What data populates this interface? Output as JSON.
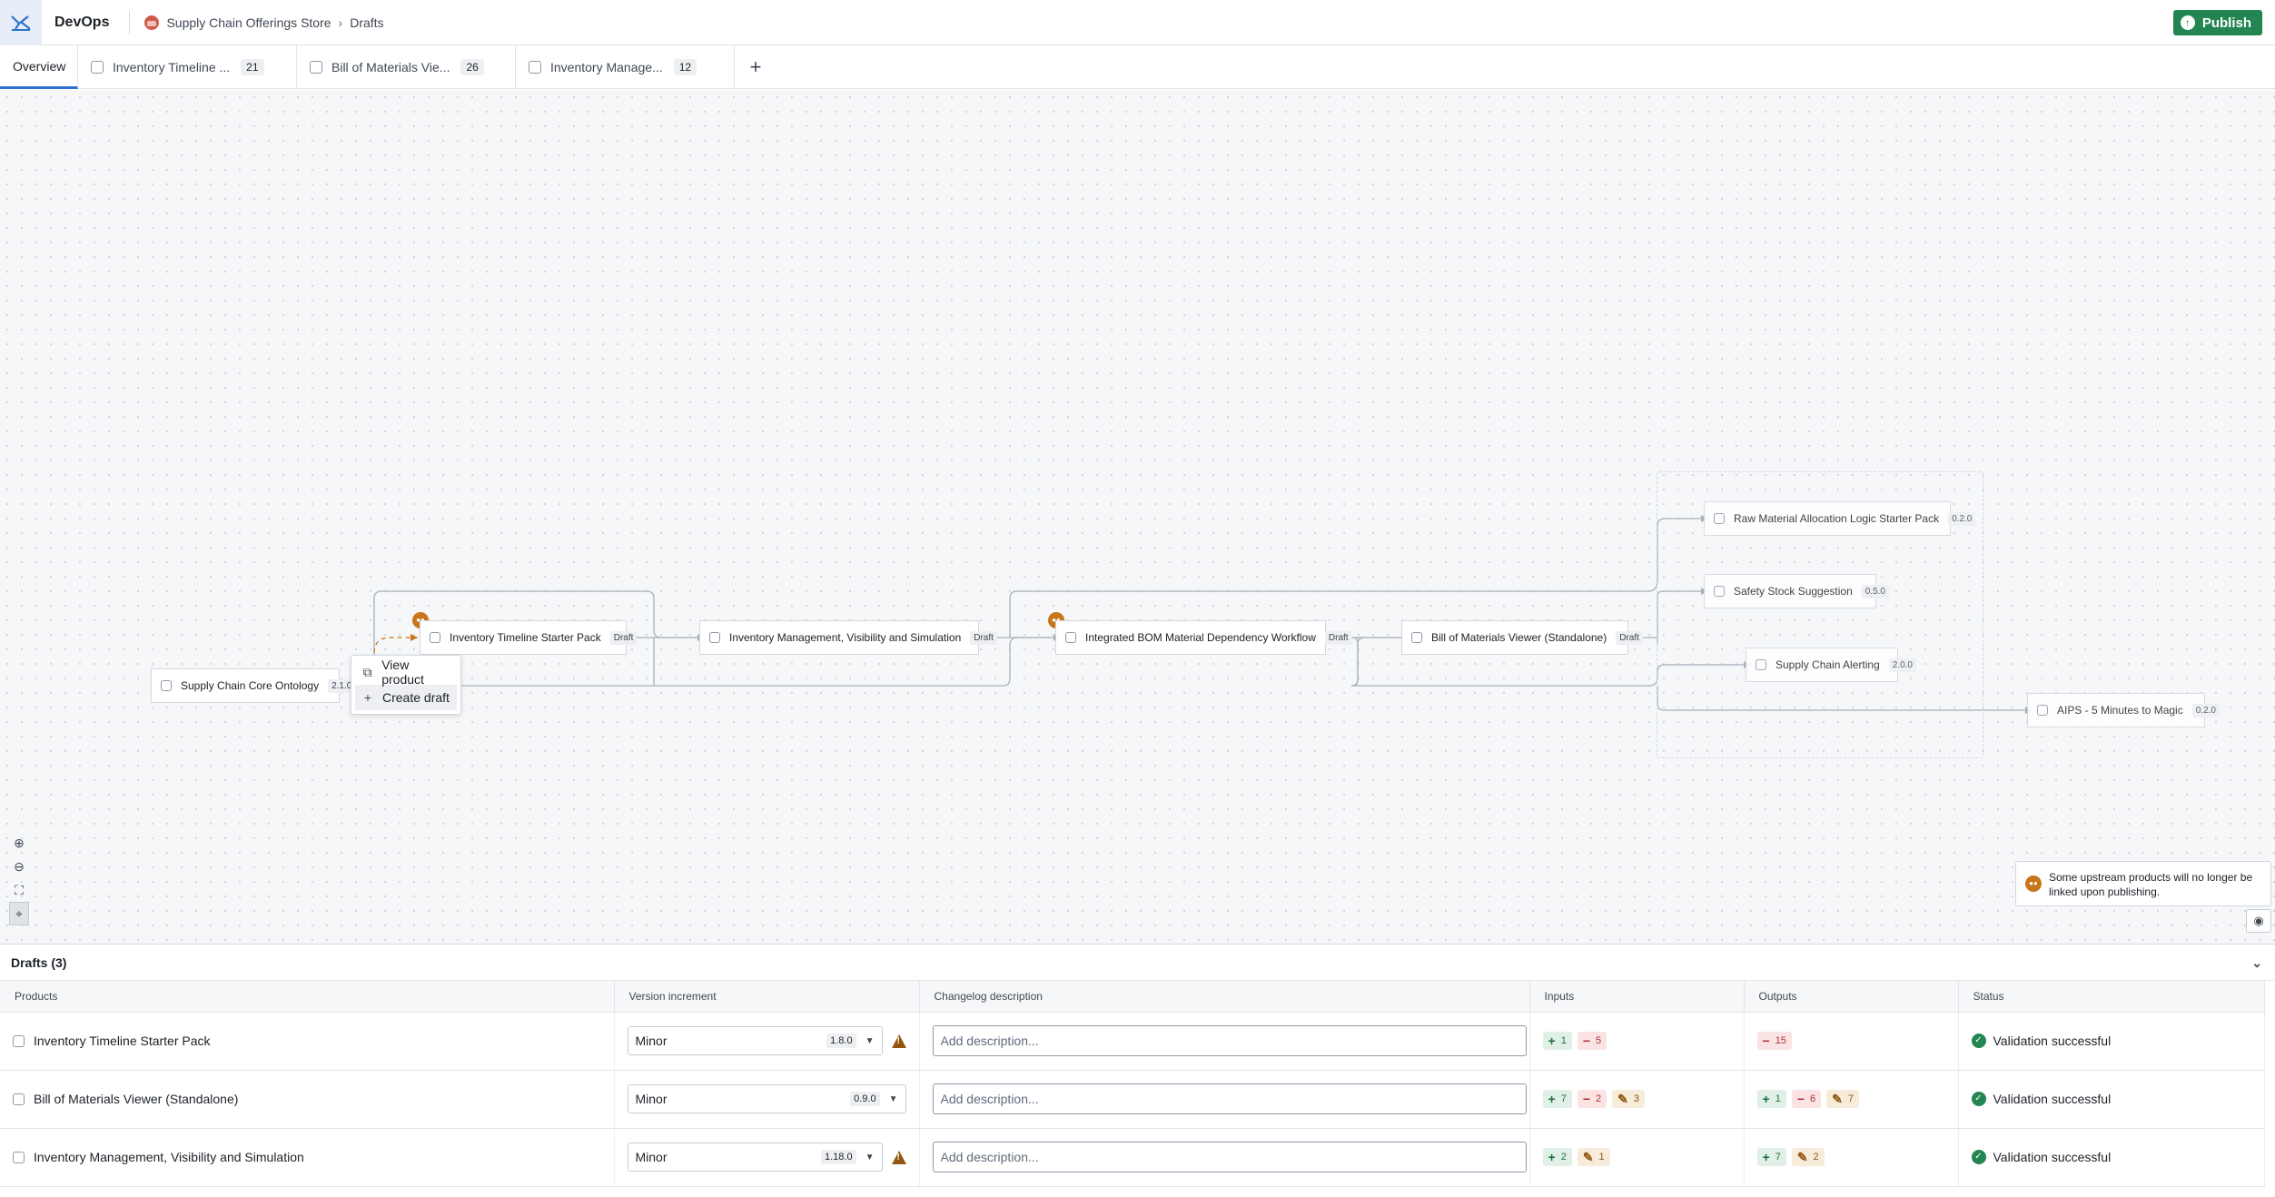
{
  "header": {
    "app_name": "DevOps",
    "breadcrumb": [
      "Supply Chain Offerings Store",
      "Drafts"
    ],
    "publish_label": "Publish"
  },
  "tabs": [
    {
      "label": "Overview",
      "count": "",
      "active": true
    },
    {
      "label": "Inventory Timeline ...",
      "count": "21"
    },
    {
      "label": "Bill of Materials Vie...",
      "count": "26"
    },
    {
      "label": "Inventory Manage...",
      "count": "12"
    }
  ],
  "graph": {
    "nodes": [
      {
        "name": "Supply Chain Core Ontology",
        "tag": "2.1.0"
      },
      {
        "name": "Inventory Timeline Starter Pack",
        "tag": "Draft"
      },
      {
        "name": "Inventory Management, Visibility and Simulation",
        "tag": "Draft"
      },
      {
        "name": "Integrated BOM Material Dependency Workflow",
        "tag": "Draft"
      },
      {
        "name": "Bill of Materials Viewer (Standalone)",
        "tag": "Draft"
      },
      {
        "name": "Raw Material Allocation Logic Starter Pack",
        "tag": "0.2.0"
      },
      {
        "name": "Safety Stock Suggestion",
        "tag": "0.5.0"
      },
      {
        "name": "Supply Chain Alerting",
        "tag": "2.0.0"
      },
      {
        "name": "AIPS - 5 Minutes to Magic",
        "tag": "0.2.0"
      }
    ],
    "context_menu": [
      "View product",
      "Create draft"
    ],
    "warning_message": "Some upstream products will no longer be linked upon publishing."
  },
  "drafts": {
    "title": "Drafts (3)",
    "columns": [
      "Products",
      "Version increment",
      "Changelog description",
      "Inputs",
      "Outputs",
      "Status"
    ],
    "description_placeholder": "Add description...",
    "rows": [
      {
        "product": "Inventory Timeline Starter Pack",
        "increment": "Minor",
        "version": "1.8.0",
        "warning": true,
        "inputs": [
          {
            "kind": "add",
            "value": "1"
          },
          {
            "kind": "rem",
            "value": "5"
          }
        ],
        "outputs": [
          {
            "kind": "rem",
            "value": "15"
          }
        ],
        "status": "Validation successful"
      },
      {
        "product": "Bill of Materials Viewer (Standalone)",
        "increment": "Minor",
        "version": "0.9.0",
        "warning": false,
        "inputs": [
          {
            "kind": "add",
            "value": "7"
          },
          {
            "kind": "rem",
            "value": "2"
          },
          {
            "kind": "mod",
            "value": "3"
          }
        ],
        "outputs": [
          {
            "kind": "add",
            "value": "1"
          },
          {
            "kind": "rem",
            "value": "6"
          },
          {
            "kind": "mod",
            "value": "7"
          }
        ],
        "status": "Validation successful"
      },
      {
        "product": "Inventory Management, Visibility and Simulation",
        "increment": "Minor",
        "version": "1.18.0",
        "warning": true,
        "inputs": [
          {
            "kind": "add",
            "value": "2"
          },
          {
            "kind": "mod",
            "value": "1"
          }
        ],
        "outputs": [
          {
            "kind": "add",
            "value": "7"
          },
          {
            "kind": "mod",
            "value": "2"
          }
        ],
        "status": "Validation successful"
      }
    ]
  },
  "colors": {
    "accent": "#2d72d2",
    "success": "#238551",
    "warning": "#c87619",
    "danger": "#ac2f33"
  }
}
